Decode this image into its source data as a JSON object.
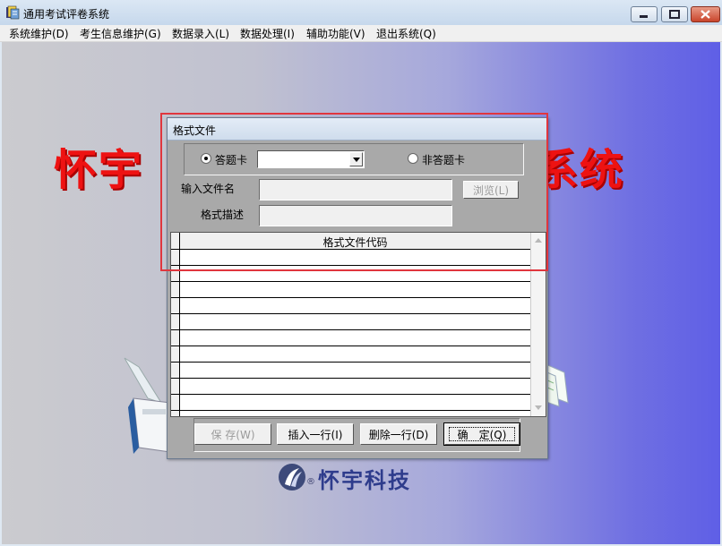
{
  "window": {
    "title": "通用考试评卷系统",
    "icon": "exam-app-icon"
  },
  "menu": [
    {
      "label": "系统维护(D)"
    },
    {
      "label": "考生信息维护(G)"
    },
    {
      "label": "数据录入(L)"
    },
    {
      "label": "数据处理(I)"
    },
    {
      "label": "辅助功能(V)"
    },
    {
      "label": "退出系统(Q)"
    }
  ],
  "background": {
    "banner_left": "怀宇",
    "banner_right": "系统",
    "logo_text": "怀宇科技",
    "logo_reg": "®"
  },
  "dialog": {
    "title": "格式文件",
    "radio_answer_card": {
      "label": "答题卡",
      "checked": true
    },
    "radio_non_answer_card": {
      "label": "非答题卡",
      "checked": false
    },
    "combo_value": "",
    "input_filename": {
      "label": "输入文件名",
      "value": ""
    },
    "browse_button": "浏览(L)",
    "format_desc": {
      "label": "格式描述",
      "value": ""
    },
    "grid": {
      "column_header": "格式文件代码",
      "rows": [
        "",
        "",
        "",
        "",
        "",
        "",
        "",
        "",
        "",
        ""
      ]
    },
    "buttons": {
      "save": "保 存(W)",
      "insert_row": "插入一行(I)",
      "delete_row": "删除一行(D)",
      "ok": "确　定(Q)"
    }
  },
  "colors": {
    "banner": "#ee1212",
    "highlight": "#e0363e",
    "logo": "#2e3c8c"
  }
}
